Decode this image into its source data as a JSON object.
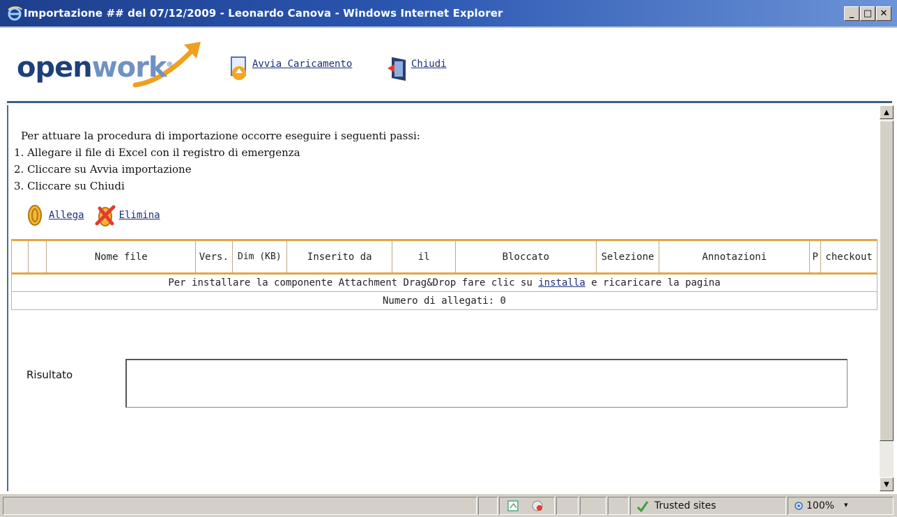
{
  "window": {
    "title": "Importazione ## del 07/12/2009 - Leonardo Canova - Windows Internet Explorer",
    "minimize_label": "_",
    "maximize_label": "□",
    "close_label": "✕"
  },
  "logo": {
    "part1": "open",
    "part2": "work",
    "reg": "®"
  },
  "toolbar": {
    "start_label": "Avvia Caricamento",
    "close_label": "Chiudi"
  },
  "instructions": {
    "intro": "Per attuare la procedura di importazione occorre eseguire i seguenti passi:",
    "steps": [
      "1. Allegare il file di Excel con il registro di emergenza",
      "2. Cliccare su Avvia importazione",
      "3. Cliccare su Chiudi"
    ]
  },
  "attachments": {
    "attach_label": "Allega",
    "delete_label": "Elimina"
  },
  "table": {
    "headers": [
      "",
      "",
      "Nome file",
      "Vers.",
      "Dim (KB)",
      "Inserito da",
      "il",
      "Bloccato",
      "Selezione",
      "Annotazioni",
      "P",
      "checkout"
    ],
    "install_prefix": "Per installare la componente Attachment Drag&Drop fare clic su ",
    "install_link": "installa",
    "install_suffix": " e ricaricare la pagina",
    "count_label": "Numero di allegati: 0"
  },
  "result": {
    "label": "Risultato",
    "value": ""
  },
  "statusbar": {
    "zone": "Trusted sites",
    "zoom": "100%",
    "zoom_caret": "▾"
  },
  "colors": {
    "title_bar": "#1e3f8c",
    "accent": "#e3a640",
    "link": "#1b2e7a"
  }
}
